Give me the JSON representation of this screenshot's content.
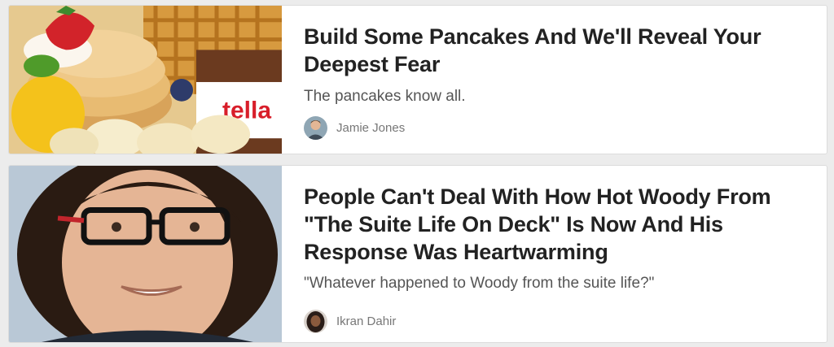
{
  "articles": [
    {
      "title": "Build Some Pancakes And We'll Reveal Your Deepest Fear",
      "description": "The pancakes know all.",
      "author": "Jamie Jones",
      "thumbnail_brand_text": "tella"
    },
    {
      "title": "People Can't Deal With How Hot Woody From \"The Suite Life On Deck\" Is Now And His Response Was Heartwarming",
      "description": "\"Whatever happened to Woody from the suite life?\"",
      "author": "Ikran Dahir"
    }
  ],
  "colors": {
    "title": "#222222",
    "description": "#555555",
    "author": "#777777",
    "card_bg": "#ffffff",
    "page_bg": "#ececec"
  }
}
